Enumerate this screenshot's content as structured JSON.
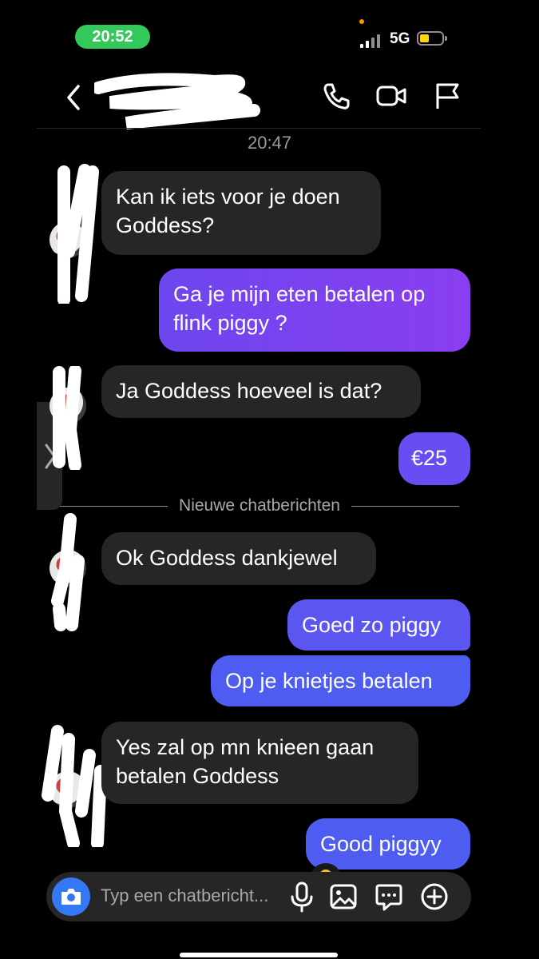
{
  "status": {
    "time": "20:52",
    "network": "5G"
  },
  "header": {
    "timestamp": "20:47"
  },
  "messages": [
    {
      "dir": "in",
      "text": "Kan ik iets voor je doen\nGoddess?"
    },
    {
      "dir": "out",
      "text": "Ga je mijn eten betalen op\nflink piggy ?"
    },
    {
      "dir": "in",
      "text": "Ja Goddess hoeveel is dat?"
    },
    {
      "dir": "out",
      "text": "€25"
    },
    {
      "dir": "in",
      "text": "Ok Goddess dankjewel"
    },
    {
      "dir": "out",
      "text": "Goed zo piggy"
    },
    {
      "dir": "out",
      "text": "Op je knietjes betalen"
    },
    {
      "dir": "in",
      "text": "Yes zal op mn knieen gaan\nbetalen Goddess"
    },
    {
      "dir": "out",
      "text": "Good piggyy"
    }
  ],
  "new_messages_label": "Nieuwe chatberichten",
  "composer": {
    "placeholder": "Typ een chatbericht..."
  },
  "icons": {
    "back": "chevron-left-icon",
    "call": "phone-icon",
    "video": "video-camera-icon",
    "report": "flag-icon",
    "camera": "camera-icon",
    "mic": "microphone-icon",
    "gallery": "image-icon",
    "stickers": "chat-bubble-icon",
    "more": "plus-circle-icon"
  },
  "colors": {
    "status_green": "#34c759",
    "camera_blue": "#3478f6",
    "incoming": "#262626",
    "outgoing_purple": "#7a42f0",
    "outgoing_blue": "#5b56f0"
  }
}
